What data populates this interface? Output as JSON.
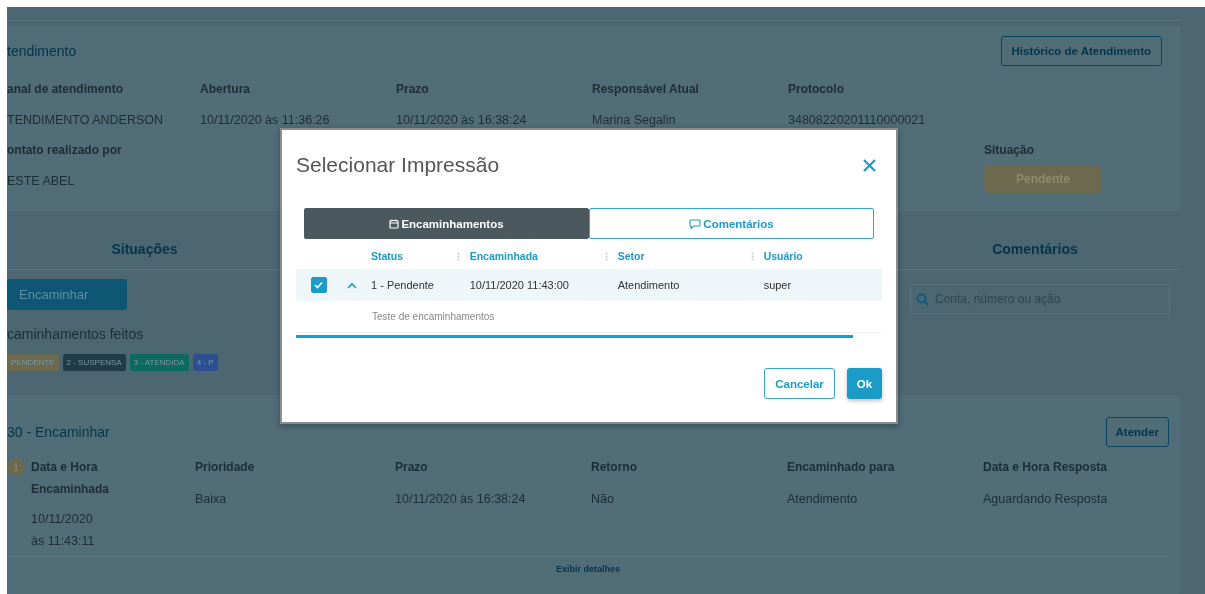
{
  "atendimento": {
    "title": "tendimento",
    "history_button": "Histórico de Atendimento",
    "fields": [
      {
        "label": "anal de atendimento",
        "value": "TENDIMENTO ANDERSON"
      },
      {
        "label": "Abertura",
        "value": "10/11/2020 às 11:36:26"
      },
      {
        "label": "Prazo",
        "value": "10/11/2020 às 16:38:24"
      },
      {
        "label": "Responsável Atual",
        "value": "Marina Segalin"
      },
      {
        "label": "Protocolo",
        "value": "34808220201110000021"
      },
      {
        "label": "ontato realizado por",
        "value": "ESTE ABEL"
      }
    ],
    "situacao": {
      "label": "Situação",
      "badge": "Pendente"
    }
  },
  "situacoes": {
    "title": "Situações",
    "button": "Encaminhar",
    "subtitle": "caminhamentos feitos",
    "legend": [
      {
        "label": "PENDENTE",
        "color": "#6b6a4f"
      },
      {
        "label": "2 - SUSPENSA",
        "color": "#203c48"
      },
      {
        "label": "3 - ATENDIDA",
        "color": "#0d6a62"
      },
      {
        "label": "4 - P",
        "color": "#2d4f8f"
      }
    ]
  },
  "comentarios": {
    "title": "Comentários",
    "search": {
      "placeholder": "Conta, número ou ação"
    }
  },
  "encaminhamento": {
    "title": "30 - Encaminhar",
    "button": "Atender",
    "index": "1",
    "fields": [
      {
        "label": "Data e Hora Encaminhada",
        "value": "10/11/2020 às 11:43:11"
      },
      {
        "label": "Prioridade",
        "value": "Baixa"
      },
      {
        "label": "Prazo",
        "value": "10/11/2020 às 16:38:24"
      },
      {
        "label": "Retorno",
        "value": "Não"
      },
      {
        "label": "Encaminhado para",
        "value": "Atendimento"
      },
      {
        "label": "Data e Hora Resposta",
        "value": "Aguardando Resposta"
      }
    ],
    "link": "Exibir detalhes"
  },
  "modal": {
    "title": "Selecionar Impressão",
    "tabs": [
      {
        "label": "Encaminhamentos",
        "selected": true
      },
      {
        "label": "Comentários",
        "selected": false
      }
    ],
    "columns": [
      "Status",
      "Encaminhada",
      "Setor",
      "Usuário"
    ],
    "rows": [
      {
        "checked": true,
        "expanded": true,
        "cells": [
          "1 - Pendente",
          "10/11/2020 11:43:00",
          "Atendimento",
          "super"
        ],
        "detail": "Teste de encaminhamentos"
      }
    ],
    "cancel": "Cancelar",
    "ok": "Ok"
  }
}
